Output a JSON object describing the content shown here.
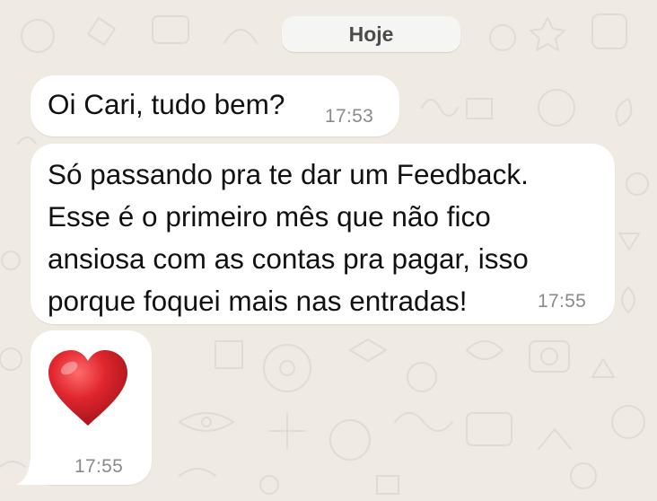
{
  "chat": {
    "date_separator": "Hoje",
    "messages": [
      {
        "text": "Oi Cari, tudo bem?",
        "time": "17:53"
      },
      {
        "text": "Só passando pra te dar um Feedback.\nEsse é o primeiro mês que não fico\nansiosa com as contas pra pagar, isso\nporque foquei  mais nas entradas!",
        "time": "17:55"
      },
      {
        "emoji": "heart-emoji",
        "time": "17:55"
      }
    ]
  },
  "colors": {
    "wallpaper": "#efeae2",
    "wallpaper_pattern": "#e2ddd5",
    "bubble": "#ffffff",
    "date_pill": "#f5f5f3",
    "text": "#111111",
    "time": "#8a8a8a",
    "heart": "#e0262e"
  }
}
